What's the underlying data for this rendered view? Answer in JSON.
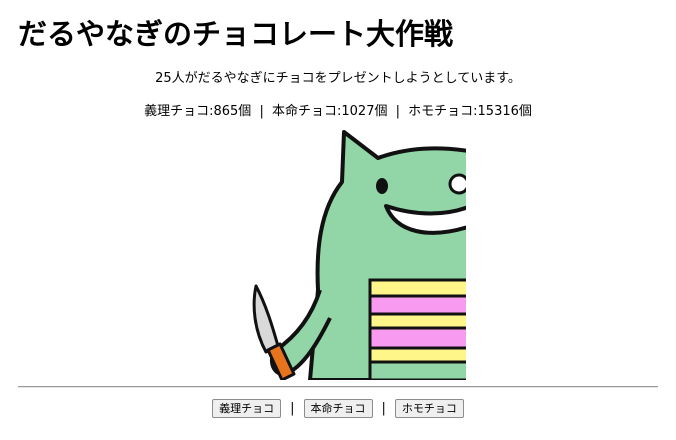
{
  "page": {
    "title": "だるやなぎのチョコレート大作戦",
    "intro": "25人がだるやなぎにチョコをプレゼントしようとしています。"
  },
  "stats": {
    "giri_label": "義理チョコ:",
    "giri_count": "865個",
    "honmei_label": "本命チョコ:",
    "honmei_count": "1027個",
    "homo_label": "ホモチョコ:",
    "homo_count": "15316個",
    "separator": "|"
  },
  "illustration": {
    "subject": "green-monster-holding-knife-and-cake",
    "colors": {
      "body": "#92d6a8",
      "outline": "#111111",
      "cake_yellow": "#fff68a",
      "cake_pink": "#f79af0",
      "knife_handle": "#e8731e",
      "blade": "#d9d9d9"
    }
  },
  "buttons": {
    "giri": "義理チョコ",
    "honmei": "本命チョコ",
    "homo": "ホモチョコ",
    "separator": "|"
  }
}
